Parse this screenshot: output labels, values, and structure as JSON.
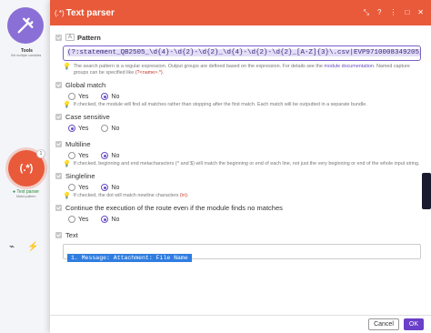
{
  "canvas": {
    "tools_label": "Tools",
    "tools_sub": "Set multiple variables",
    "tp_node_glyph": "(.*)",
    "tp_badge": "1",
    "tp_label": "Text parser",
    "tp_sub": "Match pattern"
  },
  "dialog": {
    "title": "Text parser",
    "title_icons": [
      "expand-icon",
      "help-icon",
      "more-icon",
      "maximize-icon",
      "close-icon"
    ],
    "accent": "#e85a3a"
  },
  "pattern": {
    "label": "Pattern",
    "type_badge": "A",
    "value": "(?:statement_QB2505_\\d{4}-\\d{2}-\\d{2}_\\d{4}-\\d{2}-\\d{2}_[A-Z]{3}\\.csv|EVP9710008349205_\\d{4}-\\d{2}-\\d{2",
    "hint_text_1": "The search pattern is a regular expression. Output groups are defined based on the expression. For details see the",
    "hint_link": "module documentation",
    "hint_text_2": ". Named capture groups can be specified like",
    "hint_code": "(?<name>.*)",
    "hint_end": "."
  },
  "global_match": {
    "label": "Global match",
    "yes": "Yes",
    "no": "No",
    "selected": "No",
    "hint": "If checked, the module will find all matches rather than stopping after the first match. Each match will be outputted in a separate bundle."
  },
  "case_sensitive": {
    "label": "Case sensitive",
    "yes": "Yes",
    "no": "No",
    "selected": "Yes"
  },
  "multiline": {
    "label": "Multiline",
    "yes": "Yes",
    "no": "No",
    "selected": "No",
    "hint": "If checked, beginning and end metacharacters (^ and $) will match the beginning or end of each line, not just the very beginning or end of the whole input string."
  },
  "singleline": {
    "label": "Singleline",
    "yes": "Yes",
    "no": "No",
    "selected": "No",
    "hint_text": "If checked, the dot will match newline characters",
    "hint_code": "(\\n)",
    "hint_end": "."
  },
  "continue": {
    "label": "Continue the execution of the route even if the module finds no matches",
    "yes": "Yes",
    "no": "No",
    "selected": "No"
  },
  "text": {
    "label": "Text",
    "pill": "1. Message: Attachment: File Name"
  },
  "footer": {
    "cancel": "Cancel",
    "ok": "OK"
  }
}
